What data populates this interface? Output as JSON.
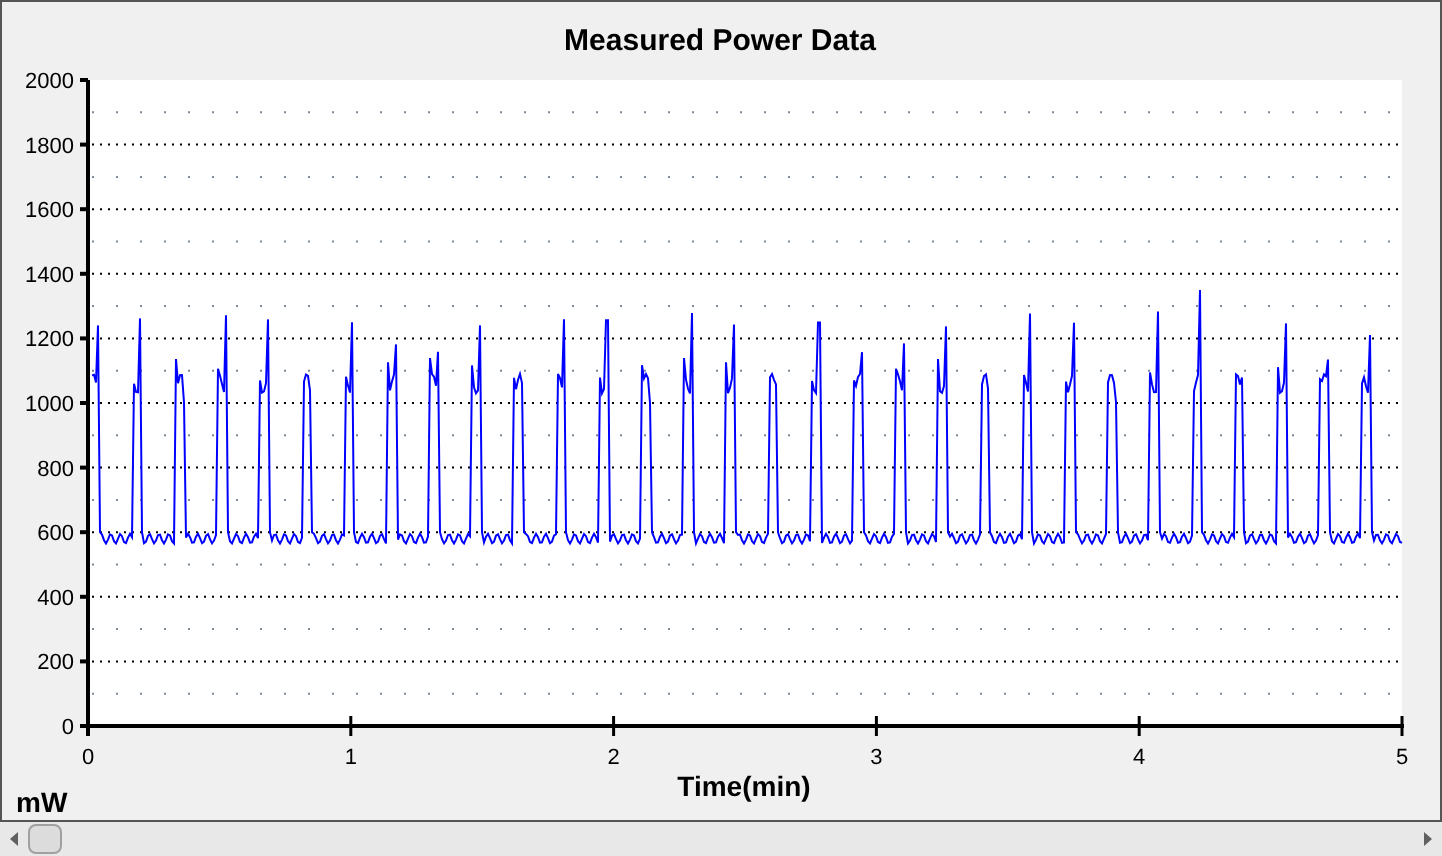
{
  "chart": {
    "title": "Measured Power Data",
    "y_axis": {
      "ticks": [
        "2000",
        "1800",
        "1600",
        "1400",
        "1200",
        "1000",
        "800",
        "600",
        "400",
        "200",
        "0"
      ],
      "unit": "mW"
    },
    "x_axis": {
      "ticks": [
        "0",
        "1",
        "2",
        "3",
        "4",
        "5"
      ],
      "label": "Time(min)"
    }
  }
}
